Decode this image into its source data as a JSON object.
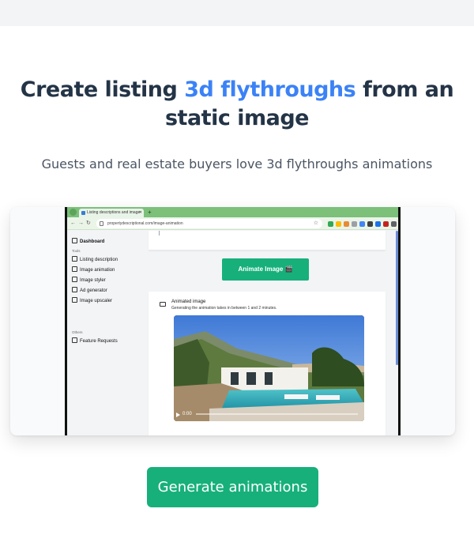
{
  "hero": {
    "title_part1": "Create listing ",
    "title_accent": "3d flythroughs",
    "title_part2": " from an static image",
    "subtitle": "Guests and real estate buyers love 3d flythroughs animations"
  },
  "screenshot": {
    "tab_title": "Listing descriptions and image",
    "url": "propertydescriptional.com/image-animation",
    "sidebar": {
      "dashboard": "Dashboard",
      "tools_section": "Tools",
      "tools": [
        "Listing description",
        "Image animation",
        "Image styler",
        "Ad generator",
        "Image upscaler"
      ],
      "others_section": "Others",
      "feature_requests": "Feature Requests"
    },
    "animate_button": "Animate Image 🎬",
    "panel_title": "Animated image",
    "panel_desc": "Generating the animation takes in between 1 and 2 minutes.",
    "video_time": "0:00"
  },
  "cta": {
    "label": "Generate animations"
  },
  "colors": {
    "accent": "#3b82f6",
    "primary_button": "#17b07b",
    "title_text": "#243447"
  }
}
